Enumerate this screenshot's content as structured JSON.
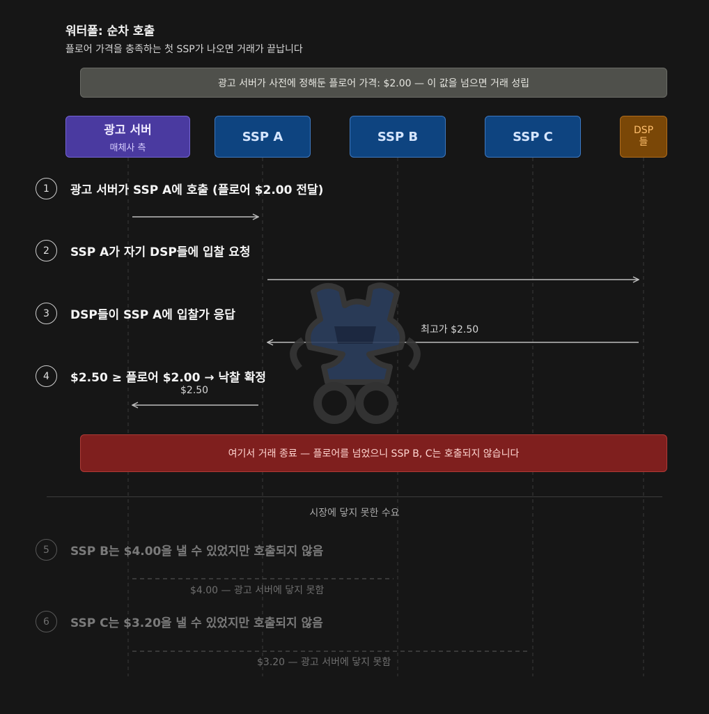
{
  "header": {
    "title": "워터폴: 순차 호출",
    "subtitle": "플로어 가격을 충족하는 첫 SSP가 나오면 거래가 끝납니다"
  },
  "floor_banner": "광고 서버가 사전에 정해둔 플로어 가격: $2.00 — 이 값을 넘으면 거래 성립",
  "actors": {
    "ad_server": {
      "name": "광고 서버",
      "sub": "매체사 측"
    },
    "ssp_a": "SSP A",
    "ssp_b": "SSP B",
    "ssp_c": "SSP C",
    "dsp_line1": "DSP",
    "dsp_line2": "들"
  },
  "steps": [
    {
      "num": "1",
      "label": "광고 서버가 SSP A에 호출 (플로어 $2.00 전달)"
    },
    {
      "num": "2",
      "label": "SSP A가 자기 DSP들에 입찰 요청"
    },
    {
      "num": "3",
      "label": "DSP들이 SSP A에 입찰가 응답"
    },
    {
      "num": "4",
      "label": "$2.50 ≥ 플로어 $2.00 → 낙찰 확정"
    },
    {
      "num": "5",
      "label": "SSP B는 $4.00을 낼 수 있었지만 호출되지 않음"
    },
    {
      "num": "6",
      "label": "SSP C는 $3.20을 낼 수 있었지만 호출되지 않음"
    }
  ],
  "arrow_labels": {
    "step3": "최고가 $2.50",
    "step4": "$2.50",
    "step5": "$4.00 — 광고 서버에 닿지 못함",
    "step6": "$3.20 — 광고 서버에 닿지 못함"
  },
  "stop_banner": "여기서 거래 종료 — 플로어를 넘었으니 SSP B, C는 호출되지 않습니다",
  "section_label": "시장에 닿지 못한 수요",
  "colors": {
    "background": "#161616",
    "ad_server": "#4a3aa0",
    "ssp": "#0e4480",
    "dsp": "#7a4707",
    "stop": "#7f1f1e",
    "floor": "#4f504b"
  }
}
